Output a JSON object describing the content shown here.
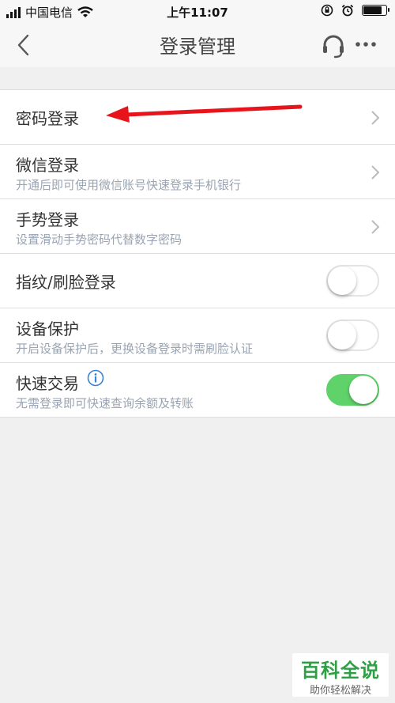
{
  "status_bar": {
    "carrier": "中国电信",
    "time": "上午11:07"
  },
  "nav": {
    "title": "登录管理",
    "back_icon": "chevron-left-icon",
    "support_icon": "headset-icon",
    "more_icon": "more-dots-icon"
  },
  "settings": [
    {
      "title": "密码登录",
      "subtitle": "",
      "control": "chevron"
    },
    {
      "title": "微信登录",
      "subtitle": "开通后即可使用微信账号快速登录手机银行",
      "control": "chevron"
    },
    {
      "title": "手势登录",
      "subtitle": "设置滑动手势密码代替数字密码",
      "control": "chevron"
    },
    {
      "title": "指纹/刷脸登录",
      "subtitle": "",
      "control": "toggle",
      "on": false
    },
    {
      "title": "设备保护",
      "subtitle": "开启设备保护后，更换设备登录时需刷脸认证",
      "control": "toggle",
      "on": false
    },
    {
      "title": "快速交易",
      "subtitle": "无需登录即可快速查询余额及转账",
      "control": "toggle",
      "on": true,
      "info_icon": "info-icon"
    }
  ],
  "colors": {
    "toggle_on": "#5fd26a",
    "annotation_arrow": "#e8141c",
    "watermark_green": "#2e9f45"
  },
  "watermark": {
    "main": "百科全说",
    "sub": "助你轻松解决"
  }
}
